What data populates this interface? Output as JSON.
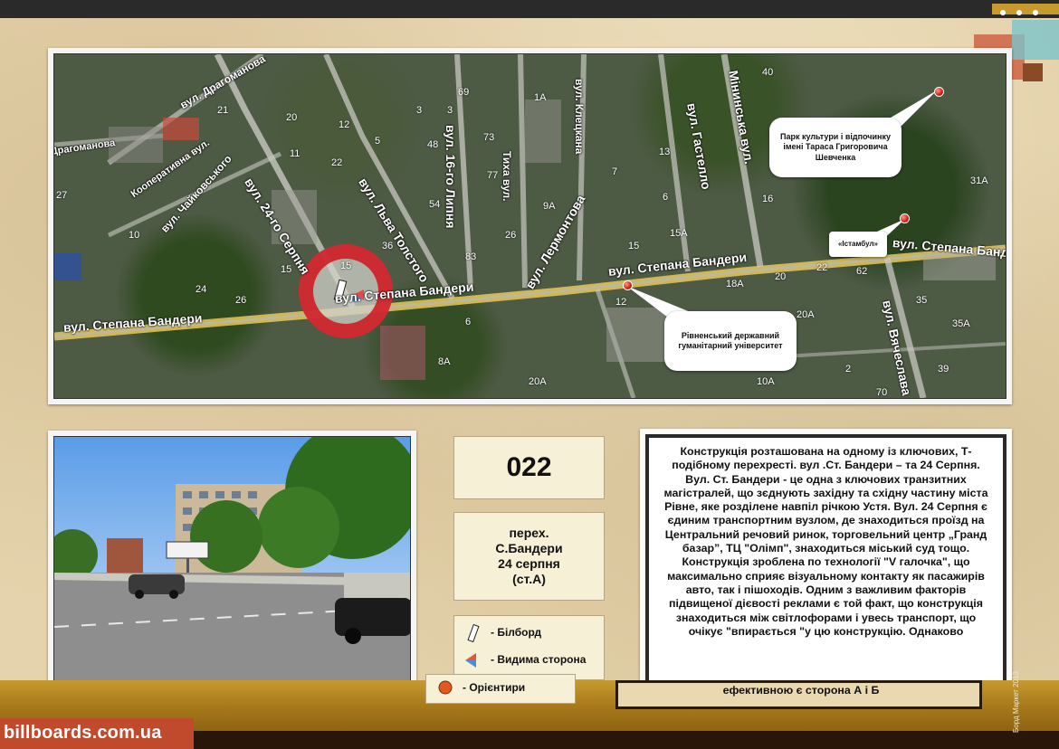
{
  "brand": {
    "site": "billboards.com.ua",
    "side_credit": "Борд Маркет 2013"
  },
  "board_id": "022",
  "location": {
    "lines": [
      "перех.",
      "С.Бандери",
      "24 серпня",
      "(ст.А)"
    ]
  },
  "legend": {
    "items": [
      {
        "icon": "billboard-icon",
        "label": "- Білборд"
      },
      {
        "icon": "arrow-icon",
        "label": "- Видима сторона"
      },
      {
        "icon": "landmark-dot-icon",
        "label": "- Орієнтири"
      }
    ]
  },
  "map": {
    "streets": [
      "вул. Степана Бандери",
      "вул. Степана Бандери",
      "вул. Степана Бандери",
      "вул. Степана Бандери",
      "вул. 24-го Серпня",
      "вул. Льва Толстого",
      "вул. 16-го Липня",
      "вул. Драгоманова",
      "вул. Чайковського",
      "Кооперативна вул.",
      "вул. Лермонтова",
      "вул. Клецкана",
      "вул. Гастелло",
      "Мінинська вул.",
      "вул. Вячеслава",
      "Тиха вул.",
      "Драгоманова"
    ],
    "house_numbers": [
      "69",
      "21",
      "20",
      "3",
      "12",
      "5",
      "48",
      "73",
      "1А",
      "11",
      "22",
      "27",
      "77",
      "54",
      "13",
      "9А",
      "7",
      "6",
      "16",
      "15",
      "15А",
      "10",
      "36",
      "83",
      "26",
      "15",
      "24",
      "26",
      "15",
      "12",
      "40",
      "31А",
      "20",
      "22",
      "62",
      "20А",
      "18А",
      "35",
      "35А",
      "6",
      "8А",
      "20А",
      "10А",
      "2",
      "39",
      "70",
      "3"
    ],
    "landmarks": [
      {
        "name": "Парк культури і відпочинку імені Тараса Григоровича Шевченка"
      },
      {
        "name": "«Істамбул»"
      },
      {
        "name": "Рівненський державний гуманітарний університет"
      }
    ]
  },
  "description": {
    "text": "Конструкція розташована на одному із ключових, Т-подібному перехресті. вул .Ст. Бандери  – та 24 Серпня. Вул. Ст. Бандери - це одна з ключових транзитних магістралей, що зєднують західну та східну частину міста Рівне, яке розділене навпіл річкою Устя.  Вул. 24 Серпня є єдиним транспортним вузлом, де знаходиться проїзд на Центральний речовий ринок, торговельний центр „Гранд базар”, ТЦ \"Олімп\", знаходиться міський суд тощо. Конструкція зроблена по технології \"V галочка\", що максимально сприяє візуальному контакту як пасажирів авто, так і пішоходів. Одним з важливим факторів підвищеної дієвості реклами є той факт, що конструкція знаходиться між світлофорами і увесь транспорт, що очікує \"впирається \"у цю конструкцію. Однаково",
    "tail": "ефективною є сторона А і Б"
  },
  "colors": {
    "accent": "#c24a2c",
    "band": "#a97a1c",
    "target_ring": "#d2141e"
  }
}
